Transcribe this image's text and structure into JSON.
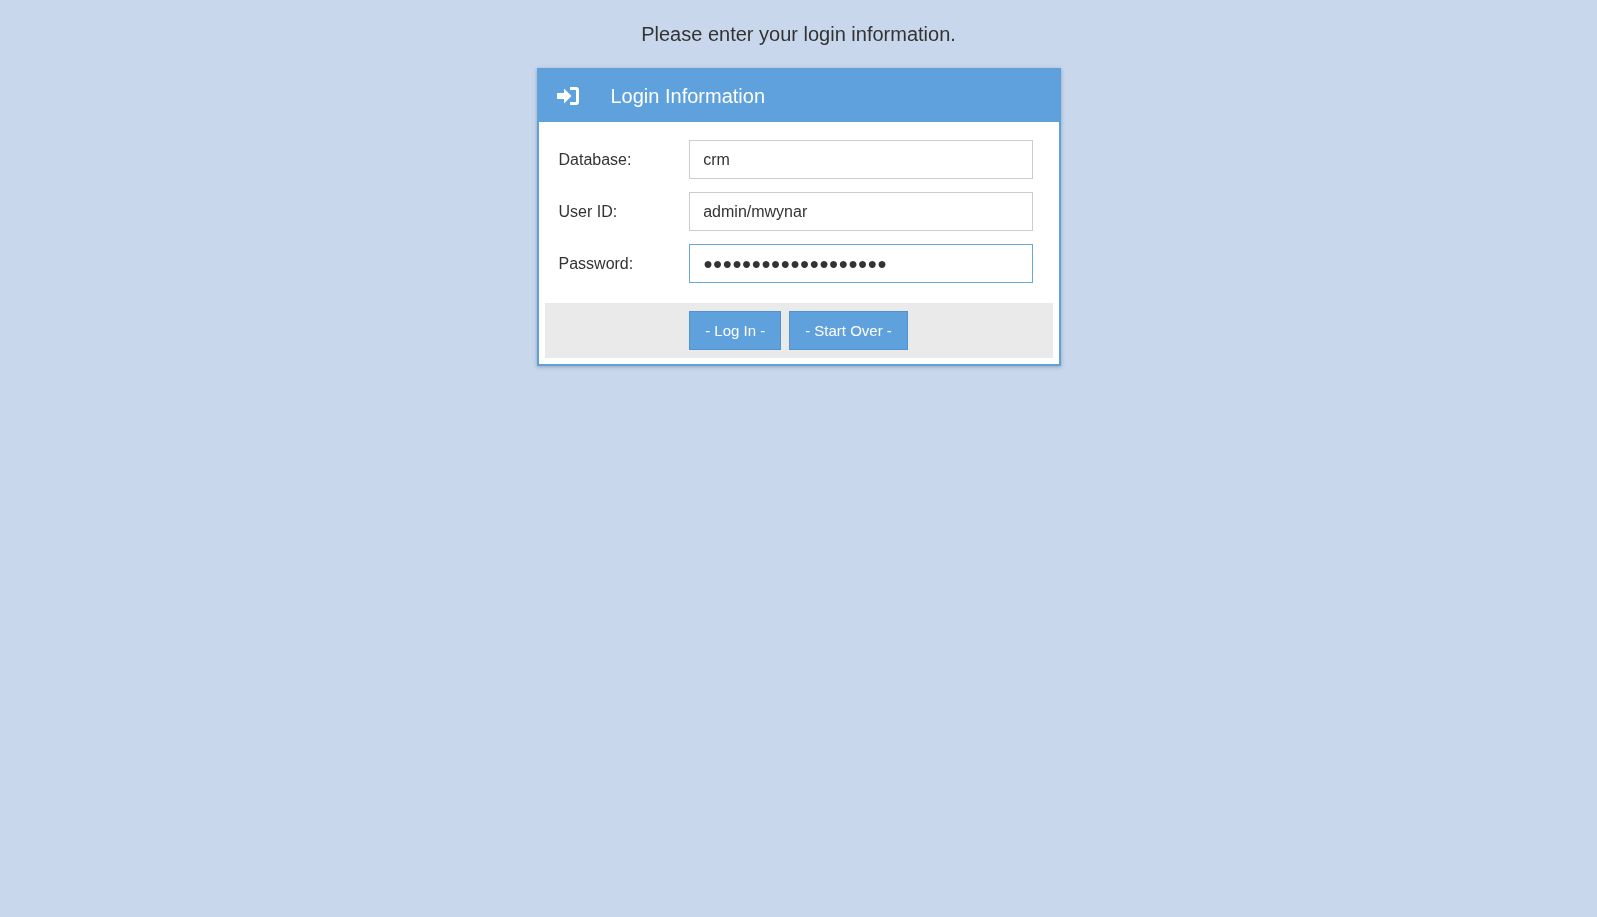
{
  "heading": "Please enter your login information.",
  "panel": {
    "title": "Login Information",
    "fields": [
      {
        "label": "Database:",
        "value": "crm",
        "focused": false
      },
      {
        "label": "User ID:",
        "value": "admin/mwynar",
        "focused": false
      },
      {
        "label": "Password:",
        "value": "●●●●●●●●●●●●●●●●●●●",
        "focused": true
      }
    ],
    "buttons": [
      "- Log In -",
      "- Start Over -"
    ]
  }
}
